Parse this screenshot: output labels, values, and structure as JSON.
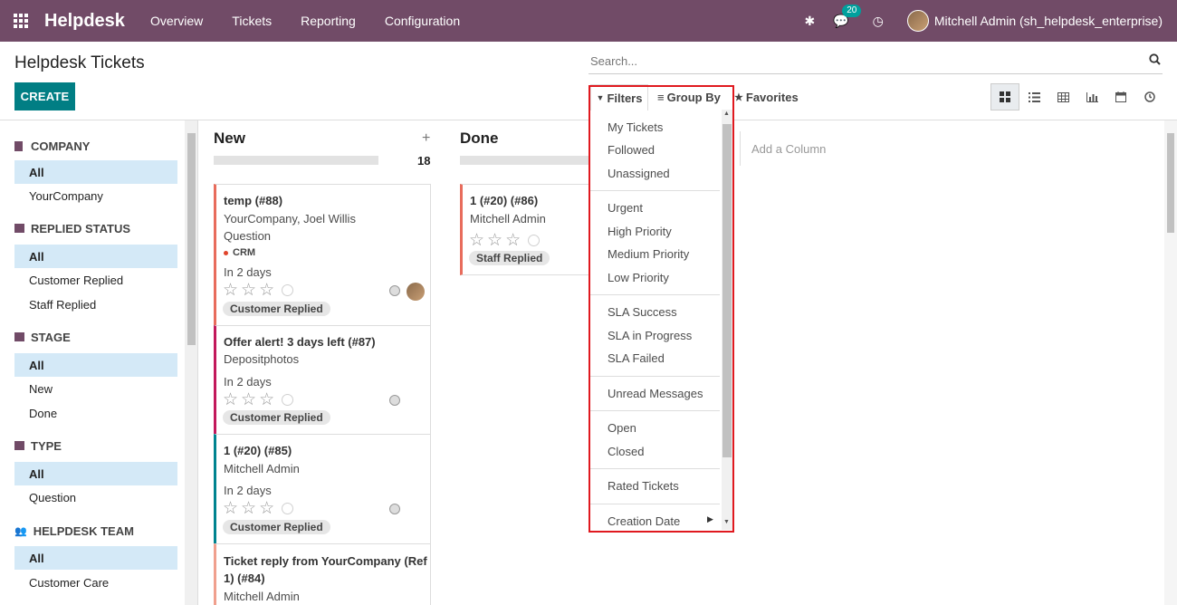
{
  "navbar": {
    "brand": "Helpdesk",
    "menu": [
      "Overview",
      "Tickets",
      "Reporting",
      "Configuration"
    ],
    "messages_count": "20",
    "user": "Mitchell Admin (sh_helpdesk_enterprise)"
  },
  "control_panel": {
    "title": "Helpdesk Tickets",
    "create_label": "CREATE",
    "search_placeholder": "Search...",
    "filters_label": "Filters",
    "groupby_label": "Group By",
    "favorites_label": "Favorites"
  },
  "sidebar": {
    "company": {
      "heading": "COMPANY",
      "items": [
        "All",
        "YourCompany"
      ]
    },
    "replied_status": {
      "heading": "REPLIED STATUS",
      "items": [
        "All",
        "Customer Replied",
        "Staff Replied"
      ]
    },
    "stage": {
      "heading": "STAGE",
      "items": [
        "All",
        "New",
        "Done"
      ]
    },
    "type": {
      "heading": "TYPE",
      "items": [
        "All",
        "Question"
      ]
    },
    "helpdesk_team": {
      "heading": "HELPDESK TEAM",
      "items": [
        "All",
        "Customer Care"
      ]
    }
  },
  "kanban": {
    "columns": [
      {
        "title": "New",
        "count": "18"
      },
      {
        "title": "Done"
      }
    ],
    "add_column": "Add a Column",
    "cards_new": [
      {
        "title": "temp (#88)",
        "line1": "YourCompany, Joel Willis",
        "line2": "Question",
        "tag": "CRM",
        "deadline": "In 2 days",
        "status": "Customer Replied"
      },
      {
        "title": "Offer alert! 3 days left (#87)",
        "line1": "Depositphotos",
        "deadline": "In 2 days",
        "status": "Customer Replied"
      },
      {
        "title": "1 (#20) (#85)",
        "line1": "Mitchell Admin",
        "deadline": "In 2 days",
        "status": "Customer Replied"
      },
      {
        "title_l1": "Ticket reply from YourCompany (Ref",
        "title_l2": "1) (#84)",
        "line1": "Mitchell Admin"
      }
    ],
    "cards_done": [
      {
        "title": "1 (#20) (#86)",
        "line1": "Mitchell Admin",
        "status": "Staff Replied"
      }
    ]
  },
  "filters_dropdown": {
    "items": [
      "My Tickets",
      "Followed",
      "Unassigned",
      "Urgent",
      "High Priority",
      "Medium Priority",
      "Low Priority",
      "SLA Success",
      "SLA in Progress",
      "SLA Failed",
      "Unread Messages",
      "Open",
      "Closed",
      "Rated Tickets",
      "Creation Date"
    ]
  },
  "colors": {
    "navbar": "#714b67",
    "primary_button": "#017e84",
    "highlight_border": "#e0191f",
    "active_filter_bg": "#d4e9f7"
  },
  "icons": {
    "apps": "apps-grid-icon",
    "debug": "bug-icon",
    "messages": "chat-icon",
    "activities": "clock-icon",
    "search": "search-icon",
    "filter": "funnel-icon",
    "groupby": "list-icon",
    "favorites": "star-icon"
  }
}
